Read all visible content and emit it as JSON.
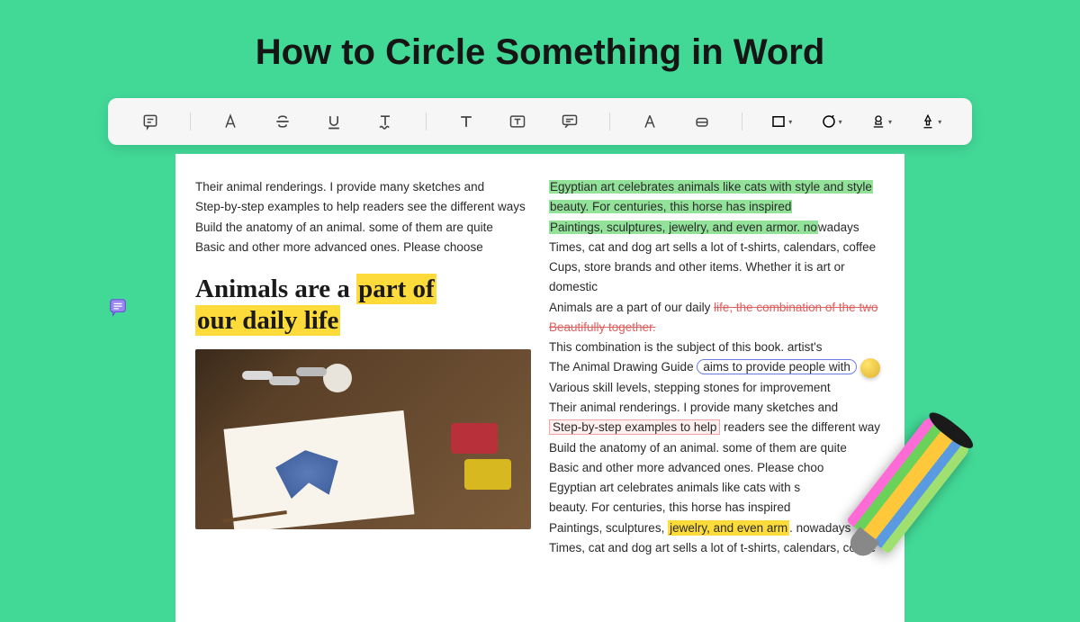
{
  "title": "How to Circle Something in Word",
  "toolbar": {
    "icons": [
      "note",
      "highlighter",
      "strikethrough",
      "underline",
      "squiggle",
      "text",
      "textbox",
      "quote",
      "pencil",
      "eraser",
      "rectangle",
      "circle",
      "stamp",
      "signature"
    ]
  },
  "left_column": {
    "intro_lines": [
      "Their animal renderings. I provide many sketches and",
      "Step-by-step examples to help readers see the different ways",
      "Build the anatomy of an animal. some of them are quite",
      "Basic and other more advanced ones. Please choose"
    ],
    "heading_plain": "Animals are a ",
    "heading_hl_1": "part of",
    "heading_hl_2": "our daily life"
  },
  "right_column": {
    "l1": "Egyptian art celebrates animals like cats with style and style",
    "l2a": "beauty. For centuries, this horse has inspired",
    "l3a": "Paintings, sculptures, jewelry, and even armor. no",
    "l3b": "wadays",
    "l4": "Times, cat and dog art sells a lot of t-shirts, calendars, coffee",
    "l5": "Cups, store brands and other items. Whether it is art or domestic",
    "l6a": "Animals are a part of our daily ",
    "l6b": "life, the combination of the two",
    "l7": "Beautifully together.",
    "l8": "This combination is the subject of this book. artist's",
    "l9a": "The Animal Drawing Guide ",
    "l9b": "aims to provide people with",
    "l10": "Various skill levels, stepping stones for improvement",
    "l11": "Their animal renderings. I provide many sketches and",
    "l12a": "Step-by-step examples to help",
    "l12b": " readers see the different way",
    "l13": "Build the anatomy of an animal. some of them are quite",
    "l14": "Basic and other more advanced ones. Please choo",
    "l15": "Egyptian art celebrates animals like cats with s",
    "l16": "beauty. For centuries, this horse has inspired",
    "l17a": "Paintings, sculptures, ",
    "l17b": "jewelry, and even arm",
    "l17c": ". nowadays",
    "l18": "Times, cat and dog art sells a lot of t-shirts, calendars, coffee"
  }
}
